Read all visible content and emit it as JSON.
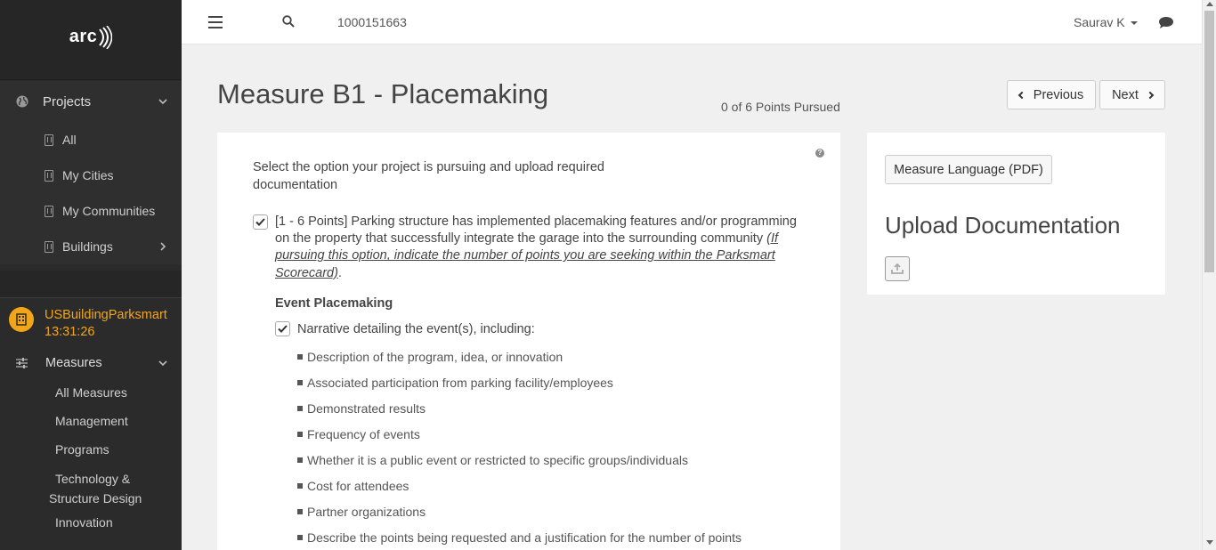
{
  "sidebar": {
    "logo": "arc",
    "projects_label": "Projects",
    "project_items": [
      {
        "label": "All",
        "icon": "building-icon"
      },
      {
        "label": "My Cities",
        "icon": "building-icon"
      },
      {
        "label": "My Communities",
        "icon": "building-icon"
      },
      {
        "label": "Buildings",
        "icon": "building-icon"
      }
    ],
    "building_name": "USBuildingParksmart 13:31:26",
    "measures_label": "Measures",
    "measure_items": [
      "All Measures",
      "Management",
      "Programs",
      "Technology & Structure Design",
      "Innovation"
    ]
  },
  "header": {
    "search_text": "1000151663",
    "user_name": "Saurav K"
  },
  "main": {
    "title": "Measure B1 - Placemaking",
    "points_pursued": "0 of 6 Points Pursued",
    "prev_label": "Previous",
    "next_label": "Next",
    "instructions": "Select the option your project is pursuing and upload required documentation",
    "option_text": "[1 - 6 Points] Parking structure has implemented placemaking features and/or programming on the property that successfully integrate the garage into the surrounding community",
    "option_note": "(If pursuing this option, indicate the number of points you are seeking within the Parksmart Scorecard)",
    "option_checked": true,
    "event_heading": "Event Placemaking",
    "narrative_label": "Narrative detailing the event(s), including:",
    "narrative_checked": true,
    "bullets": [
      "Description of the program, idea, or innovation",
      "Associated participation from parking facility/employees",
      "Demonstrated results",
      "Frequency of events",
      "Whether it is a public event or restricted to specific groups/individuals",
      "Cost for attendees",
      "Partner organizations",
      "Describe the points being requested and a justification for the number of points"
    ]
  },
  "side": {
    "pdf_button": "Measure Language (PDF)",
    "upload_title": "Upload Documentation"
  },
  "colors": {
    "sidebar_bg": "#2b2b2b",
    "accent": "#f3a51a"
  }
}
